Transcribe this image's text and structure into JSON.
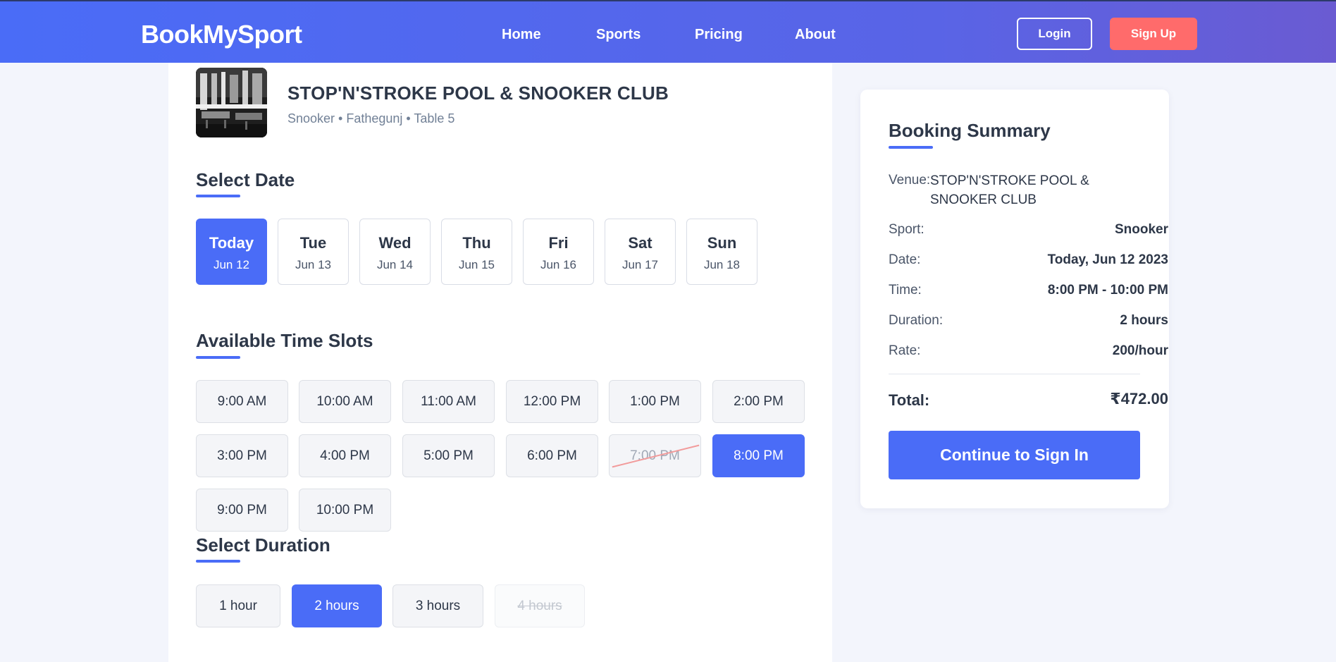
{
  "header": {
    "brand": "BookMySport",
    "nav": [
      "Home",
      "Sports",
      "Pricing",
      "About"
    ],
    "login_label": "Login",
    "signup_label": "Sign Up"
  },
  "venue": {
    "name": "STOP'N'STROKE POOL & SNOOKER CLUB",
    "meta": "Snooker • Fathegunj • Table 5"
  },
  "date_section": {
    "title": "Select Date",
    "dates": [
      {
        "day": "Today",
        "date": "Jun 12",
        "selected": true
      },
      {
        "day": "Tue",
        "date": "Jun 13"
      },
      {
        "day": "Wed",
        "date": "Jun 14"
      },
      {
        "day": "Thu",
        "date": "Jun 15"
      },
      {
        "day": "Fri",
        "date": "Jun 16"
      },
      {
        "day": "Sat",
        "date": "Jun 17"
      },
      {
        "day": "Sun",
        "date": "Jun 18"
      }
    ]
  },
  "slots_section": {
    "title": "Available Time Slots",
    "slots": [
      {
        "label": "9:00 AM"
      },
      {
        "label": "10:00 AM"
      },
      {
        "label": "11:00 AM"
      },
      {
        "label": "12:00 PM"
      },
      {
        "label": "1:00 PM"
      },
      {
        "label": "2:00 PM"
      },
      {
        "label": "3:00 PM"
      },
      {
        "label": "4:00 PM"
      },
      {
        "label": "5:00 PM"
      },
      {
        "label": "6:00 PM"
      },
      {
        "label": "7:00 PM",
        "unavailable": true
      },
      {
        "label": "8:00 PM",
        "selected": true
      },
      {
        "label": "9:00 PM"
      },
      {
        "label": "10:00 PM"
      }
    ]
  },
  "duration_section": {
    "title": "Select Duration",
    "options": [
      {
        "label": "1 hour"
      },
      {
        "label": "2 hours",
        "selected": true
      },
      {
        "label": "3 hours"
      },
      {
        "label": "4 hours",
        "unavailable": true
      }
    ]
  },
  "summary": {
    "title": "Booking Summary",
    "venue_label": "Venue:",
    "venue_value": "STOP'N'STROKE POOL & SNOOKER CLUB",
    "sport_label": "Sport:",
    "sport_value": "Snooker",
    "date_label": "Date:",
    "date_value": "Today, Jun 12 2023",
    "time_label": "Time:",
    "time_value": "8:00 PM - 10:00 PM",
    "duration_label": "Duration:",
    "duration_value": "2 hours",
    "rate_label": "Rate:",
    "rate_value": "200/hour",
    "total_label": "Total:",
    "total_value": "₹472.00",
    "continue_label": "Continue to Sign In"
  },
  "colors": {
    "accent": "#4a6cf7",
    "signup": "#ff6b6b",
    "strike": "#f29b9b"
  }
}
